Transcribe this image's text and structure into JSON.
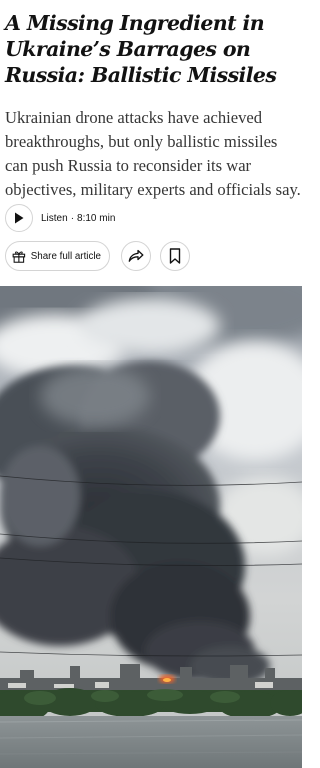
{
  "article": {
    "headline": "A Missing Ingredient in Ukraine’s Barrages on Russia: Ballistic Missiles",
    "summary": "Ukrainian drone attacks have achieved breakthroughs, but only ballistic missiles can push Russia to reconsider its war objectives, military experts and officials say."
  },
  "audio": {
    "listen_label": "Listen",
    "separator": "·",
    "duration": "8:10 min",
    "play_icon": "play-icon"
  },
  "actions": {
    "share_full_label": "Share full article",
    "gift_icon": "gift-icon",
    "share_icon": "share-arrow-icon",
    "bookmark_icon": "bookmark-icon"
  },
  "colors": {
    "text": "#121212",
    "summary_text": "#363636",
    "border": "#d4d4d4"
  }
}
